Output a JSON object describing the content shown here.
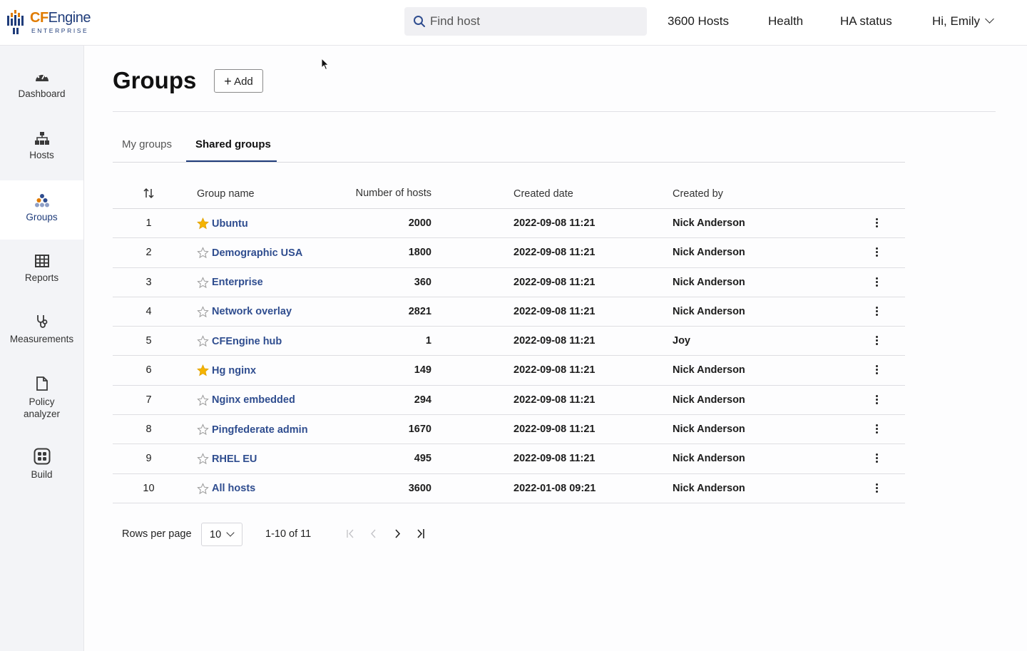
{
  "app": {
    "logo_cf": "CF",
    "logo_engine": "Engine",
    "logo_sub": "ENTERPRISE"
  },
  "topbar": {
    "search_placeholder": "Find host",
    "hosts_link": "3600 Hosts",
    "health_link": "Health",
    "ha_status_link": "HA status",
    "user_greeting": "Hi, Emily"
  },
  "sidebar": {
    "items": [
      {
        "label": "Dashboard",
        "icon": "dashboard-gauge-icon"
      },
      {
        "label": "Hosts",
        "icon": "hosts-hierarchy-icon"
      },
      {
        "label": "Groups",
        "icon": "groups-dots-icon",
        "active": true
      },
      {
        "label": "Reports",
        "icon": "table-grid-icon"
      },
      {
        "label": "Measurements",
        "icon": "stethoscope-icon"
      },
      {
        "label": "Policy analyzer",
        "icon": "document-icon"
      },
      {
        "label": "Build",
        "icon": "build-modules-icon"
      }
    ]
  },
  "page": {
    "title": "Groups",
    "add_label": "Add"
  },
  "tabs": [
    {
      "label": "My groups",
      "active": false
    },
    {
      "label": "Shared groups",
      "active": true
    }
  ],
  "table": {
    "headers": {
      "group_name": "Group name",
      "number_of_hosts": "Number of hosts",
      "created_date": "Created date",
      "created_by": "Created by"
    },
    "rows": [
      {
        "num": "1",
        "name": "Ubuntu",
        "favorite": true,
        "hosts": "2000",
        "date": "2022-09-08 11:21",
        "by": "Nick Anderson"
      },
      {
        "num": "2",
        "name": "Demographic USA",
        "favorite": false,
        "hosts": "1800",
        "date": "2022-09-08 11:21",
        "by": "Nick Anderson"
      },
      {
        "num": "3",
        "name": "Enterprise",
        "favorite": false,
        "hosts": "360",
        "date": "2022-09-08 11:21",
        "by": "Nick Anderson"
      },
      {
        "num": "4",
        "name": "Network overlay",
        "favorite": false,
        "hosts": "2821",
        "date": "2022-09-08 11:21",
        "by": "Nick Anderson"
      },
      {
        "num": "5",
        "name": "CFEngine hub",
        "favorite": false,
        "hosts": "1",
        "date": "2022-09-08 11:21",
        "by": "Joy"
      },
      {
        "num": "6",
        "name": "Hg nginx",
        "favorite": true,
        "hosts": "149",
        "date": "2022-09-08 11:21",
        "by": "Nick Anderson"
      },
      {
        "num": "7",
        "name": "Nginx embedded",
        "favorite": false,
        "hosts": "294",
        "date": "2022-09-08 11:21",
        "by": "Nick Anderson"
      },
      {
        "num": "8",
        "name": "Pingfederate admin",
        "favorite": false,
        "hosts": "1670",
        "date": "2022-09-08 11:21",
        "by": "Nick Anderson"
      },
      {
        "num": "9",
        "name": "RHEL EU",
        "favorite": false,
        "hosts": "495",
        "date": "2022-09-08 11:21",
        "by": "Nick Anderson"
      },
      {
        "num": "10",
        "name": "All hosts",
        "favorite": false,
        "hosts": "3600",
        "date": "2022-01-08 09:21",
        "by": "Nick Anderson"
      }
    ]
  },
  "pagination": {
    "rows_per_page_label": "Rows per page",
    "rows_per_page_value": "10",
    "range": "1-10 of 11"
  },
  "colors": {
    "brand_orange": "#e07b00",
    "brand_blue": "#1f3c7a",
    "link": "#2f4d8f",
    "star_filled": "#f5b400",
    "star_outline": "#9a9a9a"
  }
}
